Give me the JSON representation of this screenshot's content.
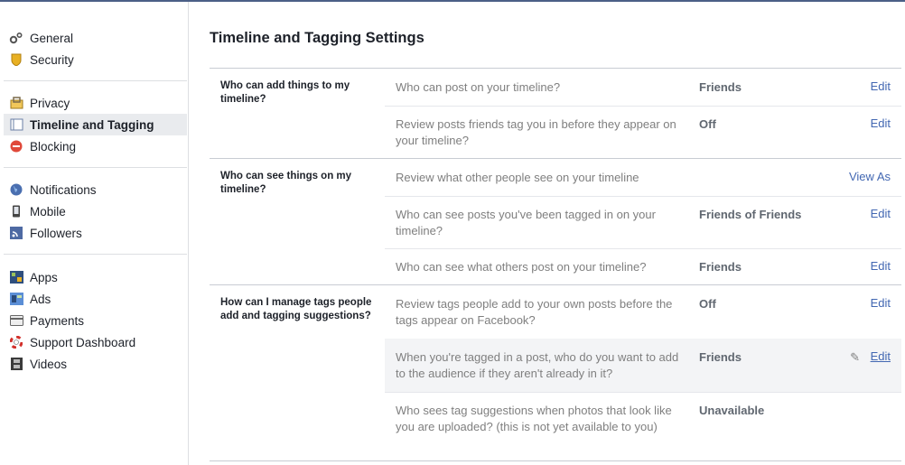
{
  "sidebar": {
    "items": [
      {
        "label": "General",
        "icon": "gear-icon"
      },
      {
        "label": "Security",
        "icon": "shield-icon"
      },
      {
        "label": "Privacy",
        "icon": "lock-icon"
      },
      {
        "label": "Timeline and Tagging",
        "icon": "timeline-icon",
        "active": true
      },
      {
        "label": "Blocking",
        "icon": "blocking-icon"
      },
      {
        "label": "Notifications",
        "icon": "globe-icon"
      },
      {
        "label": "Mobile",
        "icon": "mobile-icon"
      },
      {
        "label": "Followers",
        "icon": "rss-icon"
      },
      {
        "label": "Apps",
        "icon": "apps-icon"
      },
      {
        "label": "Ads",
        "icon": "ads-icon"
      },
      {
        "label": "Payments",
        "icon": "card-icon"
      },
      {
        "label": "Support Dashboard",
        "icon": "lifebuoy-icon"
      },
      {
        "label": "Videos",
        "icon": "film-icon"
      }
    ]
  },
  "main": {
    "title": "Timeline and Tagging Settings",
    "sections": [
      {
        "title": "Who can add things to my timeline?",
        "rows": [
          {
            "label": "Who can post on your timeline?",
            "value": "Friends",
            "action": "Edit"
          },
          {
            "label": "Review posts friends tag you in before they appear on your timeline?",
            "value": "Off",
            "action": "Edit"
          }
        ]
      },
      {
        "title": "Who can see things on my timeline?",
        "rows": [
          {
            "label": "Review what other people see on your timeline",
            "value": "",
            "action": "View As"
          },
          {
            "label": "Who can see posts you've been tagged in on your timeline?",
            "value": "Friends of Friends",
            "action": "Edit"
          },
          {
            "label": "Who can see what others post on your timeline?",
            "value": "Friends",
            "action": "Edit"
          }
        ]
      },
      {
        "title": "How can I manage tags people add and tagging suggestions?",
        "rows": [
          {
            "label": "Review tags people add to your own posts before the tags appear on Facebook?",
            "value": "Off",
            "action": "Edit"
          },
          {
            "label": "When you're tagged in a post, who do you want to add to the audience if they aren't already in it?",
            "value": "Friends",
            "action": "Edit",
            "highlighted": true
          },
          {
            "label": "Who sees tag suggestions when photos that look like you are uploaded? (this is not yet available to you)",
            "value": "Unavailable",
            "action": ""
          }
        ]
      }
    ]
  },
  "colors": {
    "link": "#4267b2",
    "active_bg": "#e9ebee",
    "top_bar": "#4b5f86"
  }
}
